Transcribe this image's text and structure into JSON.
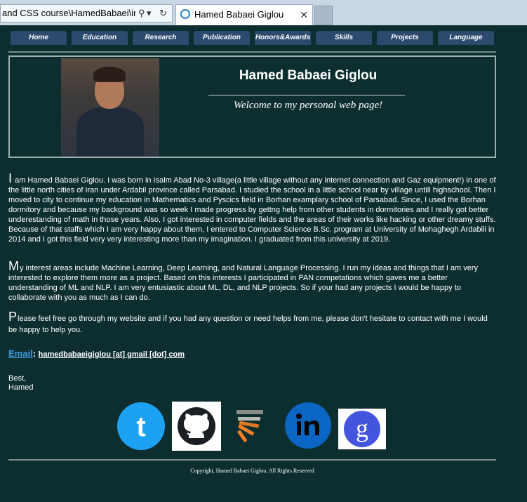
{
  "browser": {
    "address_text": "and CSS course\\HamedBabaei\\inde:",
    "search_glyph": "⚲",
    "dropdown_glyph": "▾",
    "refresh_glyph": "↻",
    "tab_title": "Hamed Babaei Giglou",
    "tab_close": "✕"
  },
  "nav": [
    "Home",
    "Education",
    "Research",
    "Publication",
    "Honors&Awards",
    "Skills",
    "Projects",
    "Language"
  ],
  "header": {
    "name": "Hamed Babaei Giglou",
    "welcome": "Welcome to my personal web page!"
  },
  "bio": {
    "p1_cap": "I",
    "p1": " am Hamed Babaei Giglou. I was born in Isalm Abad No-3 village(a little village without any internet connection and Gaz equipment!) in one of the little north cities of Iran under Ardabil province called Parsabad. I studied the school in a little school near by village untill highschool. Then I moved to city to continue my education in Mathematics and Pyscics field in Borhan examplary school of Parsabad. Since, I used the Borhan dormitory and because my background was so week I made progress by gettng help from other students in dormitories and I really got better underestanding of math in those years. Also, I got interested in computer fields and the areas of their works like hacking or other dreamy stuffs. Because of that staffs which I am very happy about them, I entered to Computer Science B.Sc. program at University of Mohaghegh Ardabili in 2014 and I got this field very very interesting more than my imagination. I graduated from this university at 2019.",
    "p2_cap": "M",
    "p2": "y interest areas include Machine Learning, Deep Learning, and Natural Language Processing. I run my ideas and things that I am very interested to explore them more as a project. Based on this interests I participated in PAN competations which gaves me a better understanding of ML and NLP. I am very entusiastic about ML, DL, and NLP projects. So if your had any projects I would be happy to collaborate with you as much as I can do.",
    "p3_cap": "P",
    "p3": "lease feel free go through my website and if you had any question or need helps from me, please don't hesitate to contact with me I would be happy to help you."
  },
  "email": {
    "label": "Email",
    "sep": ": ",
    "address": "hamedbabaeigiglou [at] gmail [dot] com"
  },
  "signature": {
    "line1": "Best,",
    "line2": "Hamed"
  },
  "social": [
    "twitter-icon",
    "github-icon",
    "stackoverflow-icon",
    "linkedin-icon",
    "google-scholar-icon"
  ],
  "colors": {
    "background": "#0d2e2f",
    "nav_button": "#2c4a6e",
    "email_label": "#3b9be0",
    "twitter": "#1da1f2",
    "linkedin": "#0a66c2",
    "scholar": "#4455dd"
  },
  "footer": {
    "copyright": "Copyright, Hamed Babaei Giglou. All Rights Reserved"
  }
}
